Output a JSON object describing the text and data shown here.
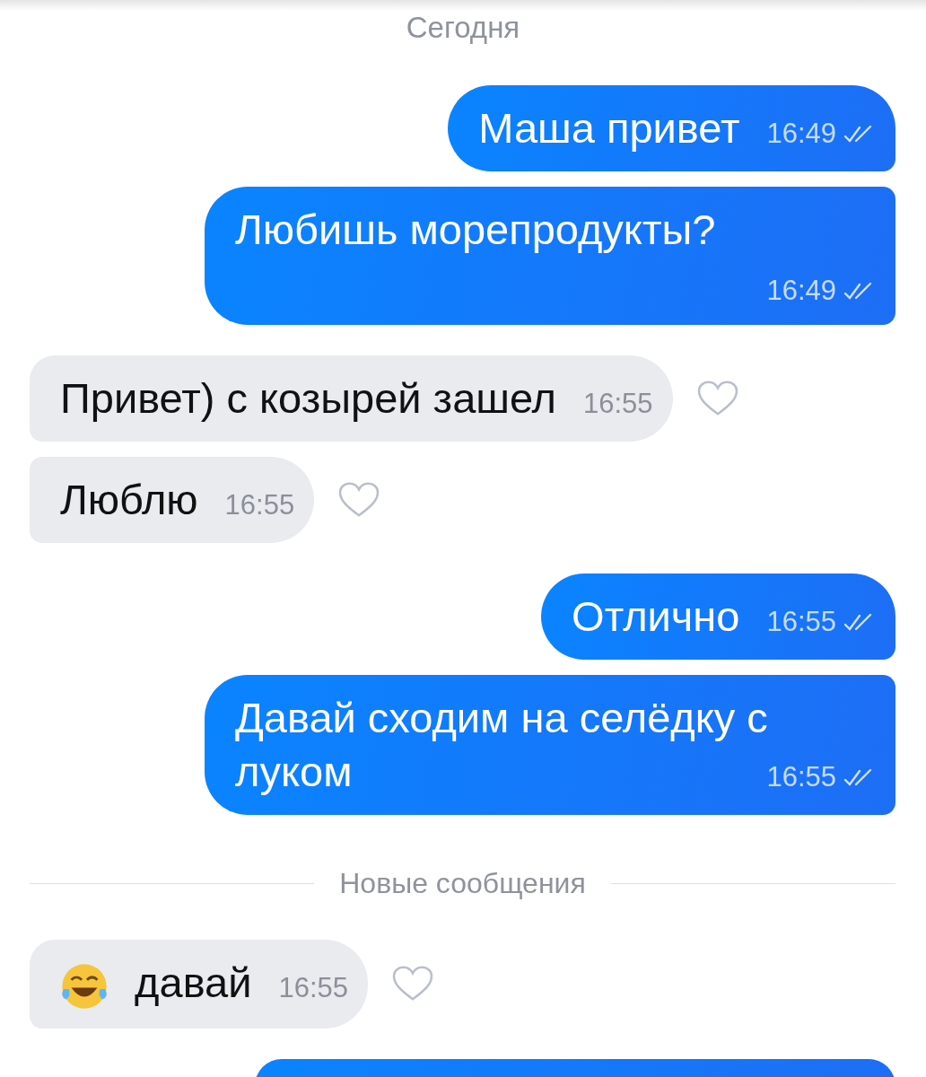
{
  "date": "Сегодня",
  "items": [
    {
      "kind": "outgoing",
      "wide": false,
      "text": "Маша привет",
      "time": "16:49",
      "read": true
    },
    {
      "kind": "outgoing",
      "wide": true,
      "text": "Любишь морепродукты?",
      "time": "16:49",
      "read": true
    },
    {
      "kind": "incoming",
      "emoji": false,
      "text": "Привет) с козырей зашел",
      "time": "16:55",
      "liked": false
    },
    {
      "kind": "incoming",
      "emoji": false,
      "text": "Люблю",
      "time": "16:55",
      "liked": false
    },
    {
      "kind": "outgoing",
      "wide": false,
      "text": "Отлично",
      "time": "16:55",
      "read": true
    },
    {
      "kind": "outgoing",
      "wide": false,
      "text": "Давай сходим на селёдку с луком",
      "time": "16:55",
      "read": true
    },
    {
      "kind": "divider",
      "text": "Новые сообщения"
    },
    {
      "kind": "incoming",
      "emoji": true,
      "text": "давай",
      "time": "16:55",
      "liked": false
    },
    {
      "kind": "stub"
    }
  ]
}
